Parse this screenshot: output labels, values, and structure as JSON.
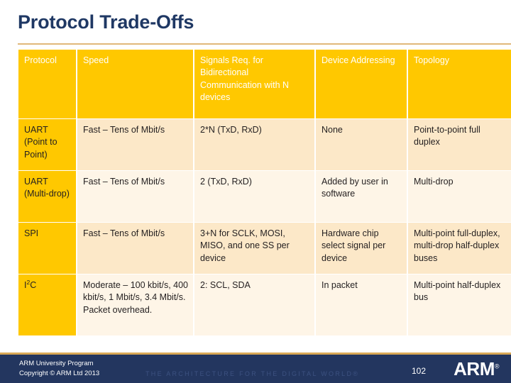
{
  "slide": {
    "title": "Protocol Trade-Offs"
  },
  "table": {
    "headers": [
      "Protocol",
      "Speed",
      "Signals Req. for Bidirectional Communication with N devices",
      "Device Addressing",
      "Topology"
    ],
    "rows": [
      {
        "protocol_main": "UART",
        "protocol_sub": "(Point to Point)",
        "speed": "Fast – Tens of Mbit/s",
        "signals": "2*N (TxD, RxD)",
        "addressing": "None",
        "topology": "Point-to-point full duplex"
      },
      {
        "protocol_main": "UART",
        "protocol_sub": "(Multi-drop)",
        "speed": "Fast – Tens of Mbit/s",
        "signals": "2 (TxD, RxD)",
        "addressing": "Added by user in software",
        "topology": "Multi-drop"
      },
      {
        "protocol_main": "SPI",
        "protocol_sub": "",
        "speed": "Fast – Tens of Mbit/s",
        "signals": "3+N for SCLK, MOSI, MISO, and one SS per device",
        "addressing": "Hardware chip select signal per device",
        "topology": "Multi-point full-duplex, multi-drop half-duplex buses"
      },
      {
        "protocol_main_prefix": "I",
        "protocol_main_sup": "2",
        "protocol_main_suffix": "C",
        "protocol_sub": "",
        "speed": "Moderate – 100 kbit/s, 400 kbit/s, 1 Mbit/s, 3.4 Mbit/s. Packet overhead.",
        "signals": "2: SCL, SDA",
        "addressing": "In packet",
        "topology": "Multi-point half-duplex bus"
      }
    ]
  },
  "footer": {
    "line1": "ARM University Program",
    "line2": "Copyright © ARM Ltd 2013",
    "tagline": "THE ARCHITECTURE FOR THE DIGITAL WORLD®",
    "page_number": "102",
    "logo_text": "ARM",
    "logo_mark": "®"
  },
  "colors": {
    "title": "#1F3864",
    "rule": "#E0B87A",
    "header_gold": "#FFC800",
    "row_dark": "#FCE8C8",
    "row_light": "#FEF5E7",
    "footer_band": "#23365F",
    "footer_border": "#D9A856"
  }
}
